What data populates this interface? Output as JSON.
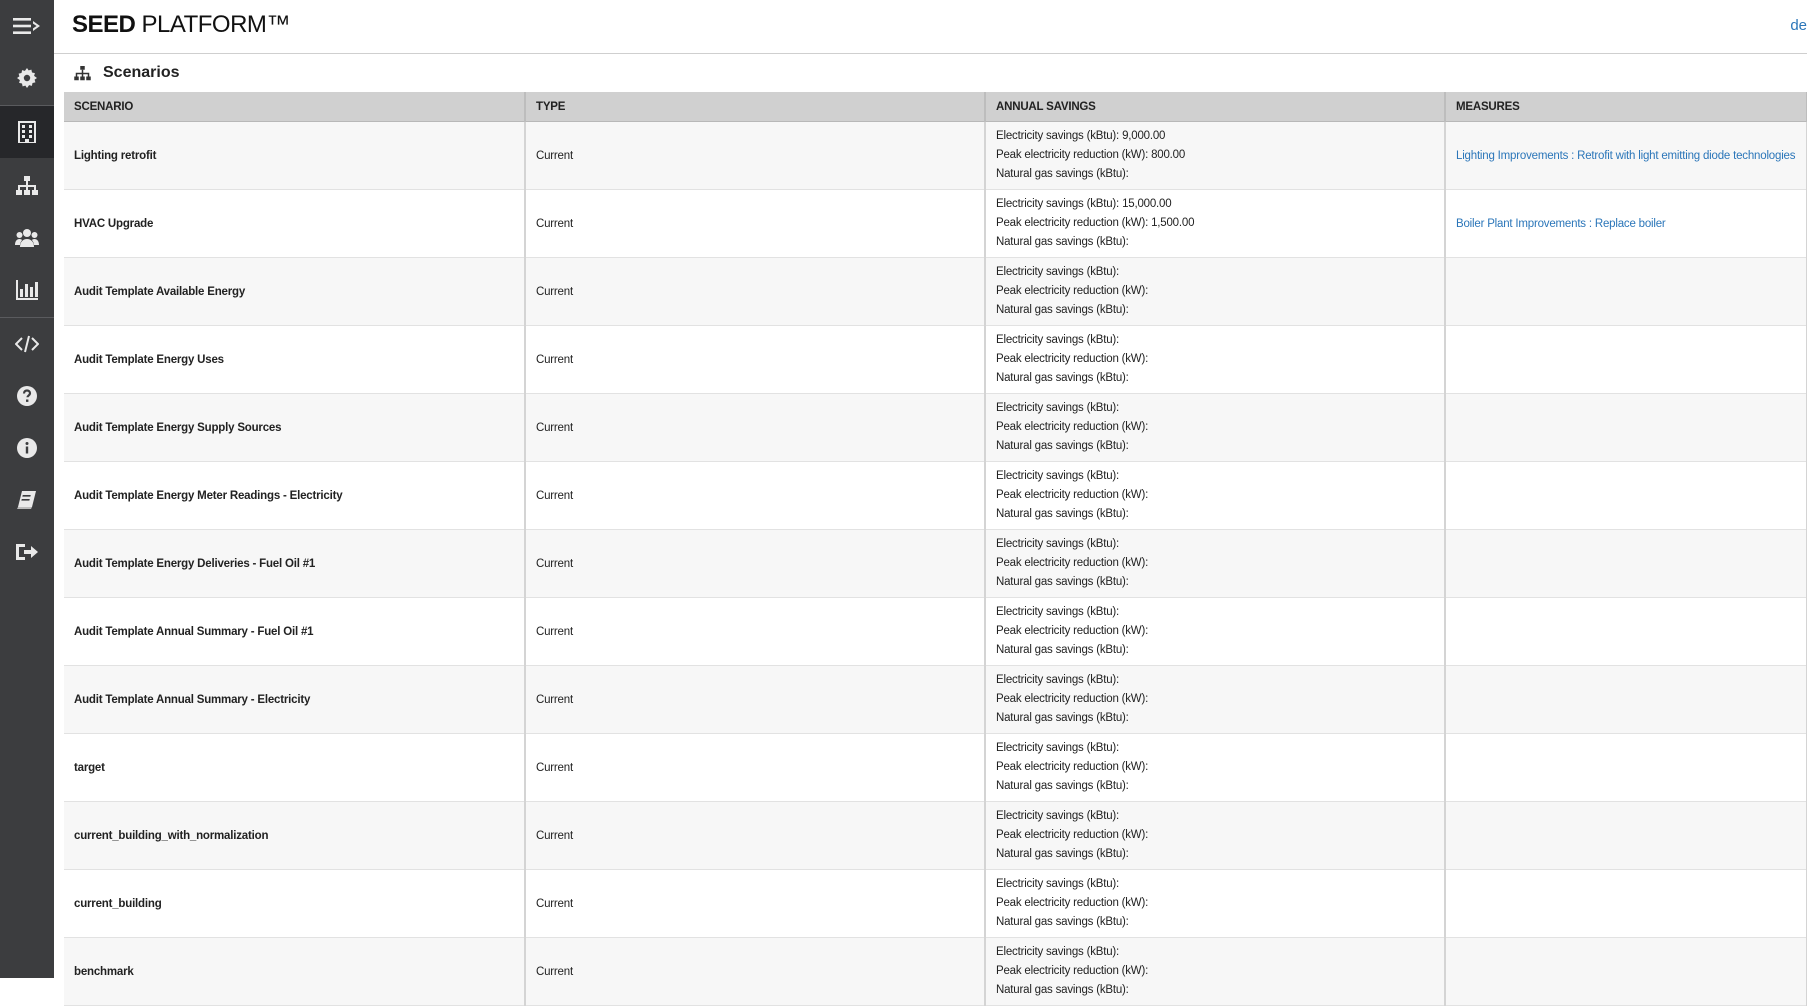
{
  "app": {
    "brand_bold": "SEED",
    "brand_rest": " PLATFORM™",
    "user_link": "de"
  },
  "section": {
    "title": "Scenarios"
  },
  "table": {
    "headers": [
      "SCENARIO",
      "TYPE",
      "ANNUAL SAVINGS",
      "MEASURES"
    ],
    "savings_labels": {
      "electricity": "Electricity savings (kBtu):",
      "peak": "Peak electricity reduction (kW):",
      "gas": "Natural gas savings (kBtu):"
    },
    "rows": [
      {
        "scenario": "Lighting retrofit",
        "type": "Current",
        "electricity": "9,000.00",
        "peak": "800.00",
        "gas": "",
        "measure": "Lighting Improvements : Retrofit with light emitting diode technologies"
      },
      {
        "scenario": "HVAC Upgrade",
        "type": "Current",
        "electricity": "15,000.00",
        "peak": "1,500.00",
        "gas": "",
        "measure": "Boiler Plant Improvements : Replace boiler"
      },
      {
        "scenario": "Audit Template Available Energy",
        "type": "Current",
        "electricity": "",
        "peak": "",
        "gas": "",
        "measure": ""
      },
      {
        "scenario": "Audit Template Energy Uses",
        "type": "Current",
        "electricity": "",
        "peak": "",
        "gas": "",
        "measure": ""
      },
      {
        "scenario": "Audit Template Energy Supply Sources",
        "type": "Current",
        "electricity": "",
        "peak": "",
        "gas": "",
        "measure": ""
      },
      {
        "scenario": "Audit Template Energy Meter Readings - Electricity",
        "type": "Current",
        "electricity": "",
        "peak": "",
        "gas": "",
        "measure": ""
      },
      {
        "scenario": "Audit Template Energy Deliveries - Fuel Oil #1",
        "type": "Current",
        "electricity": "",
        "peak": "",
        "gas": "",
        "measure": ""
      },
      {
        "scenario": "Audit Template Annual Summary - Fuel Oil #1",
        "type": "Current",
        "electricity": "",
        "peak": "",
        "gas": "",
        "measure": ""
      },
      {
        "scenario": "Audit Template Annual Summary - Electricity",
        "type": "Current",
        "electricity": "",
        "peak": "",
        "gas": "",
        "measure": ""
      },
      {
        "scenario": "target",
        "type": "Current",
        "electricity": "",
        "peak": "",
        "gas": "",
        "measure": ""
      },
      {
        "scenario": "current_building_with_normalization",
        "type": "Current",
        "electricity": "",
        "peak": "",
        "gas": "",
        "measure": ""
      },
      {
        "scenario": "current_building",
        "type": "Current",
        "electricity": "",
        "peak": "",
        "gas": "",
        "measure": ""
      },
      {
        "scenario": "benchmark",
        "type": "Current",
        "electricity": "",
        "peak": "",
        "gas": "",
        "measure": ""
      }
    ]
  },
  "sidebar": {
    "icons": [
      "menu-toggle-icon",
      "gear-icon",
      "building-icon",
      "sitemap-icon",
      "users-icon",
      "bar-chart-icon",
      "code-icon",
      "help-icon",
      "info-icon",
      "book-icon",
      "sign-out-icon"
    ]
  },
  "colors": {
    "sidebar_bg": "#3c3d3f",
    "sidebar_active": "#26272a",
    "link": "#2b76b9",
    "header_bg": "#d0d0d0"
  }
}
